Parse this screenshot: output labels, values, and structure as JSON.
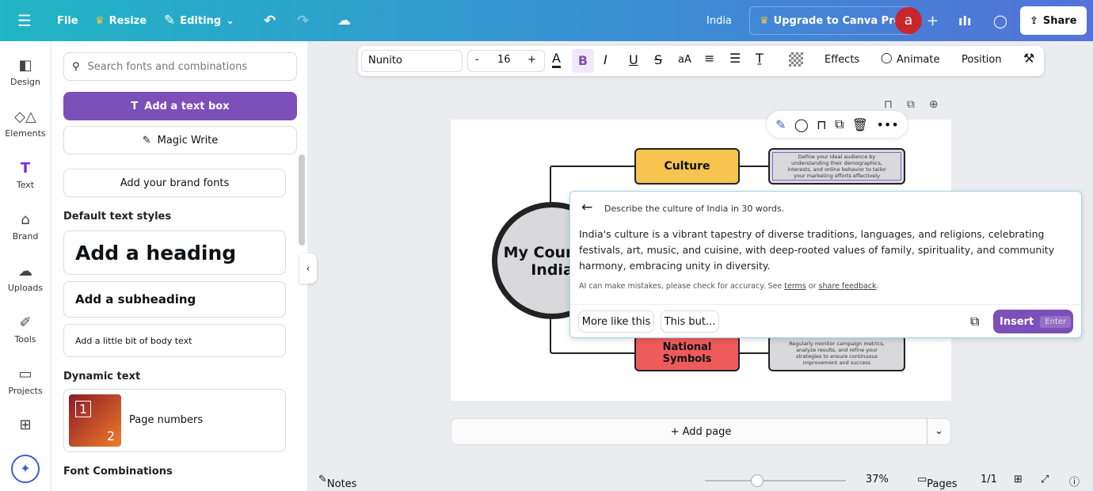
{
  "topbar": {
    "file": "File",
    "resize": "Resize",
    "editing": "Editing",
    "title": "India",
    "upgrade": "Upgrade to Canva Pro",
    "avatar": "a",
    "share": "Share"
  },
  "rail": [
    {
      "label": "Design",
      "icon": "design-icon"
    },
    {
      "label": "Elements",
      "icon": "elements-icon"
    },
    {
      "label": "Text",
      "icon": "text-icon"
    },
    {
      "label": "Brand",
      "icon": "brand-icon"
    },
    {
      "label": "Uploads",
      "icon": "uploads-icon"
    },
    {
      "label": "Tools",
      "icon": "tools-icon"
    },
    {
      "label": "Projects",
      "icon": "projects-icon"
    }
  ],
  "panel": {
    "search_placeholder": "Search fonts and combinations",
    "add_textbox": "Add a text box",
    "magic_write": "Magic Write",
    "brand_fonts": "Add your brand fonts",
    "default_styles": "Default text styles",
    "heading": "Add a heading",
    "subheading": "Add a subheading",
    "body": "Add a little bit of body text",
    "dynamic": "Dynamic text",
    "page_numbers": "Page numbers",
    "thumb_1": "1",
    "thumb_2": "2",
    "font_combos": "Font Combinations"
  },
  "toolbar": {
    "font": "Nunito",
    "minus": "-",
    "size": "16",
    "plus": "+",
    "bold": "B",
    "italic": "I",
    "underline": "U",
    "strike": "S",
    "case": "aA",
    "effects": "Effects",
    "animate": "Animate",
    "position": "Position"
  },
  "design": {
    "center_line1": "My Country",
    "center_line2": "India",
    "culture": "Culture",
    "culture_text": "Define your ideal audience by understanding their demographics, interests, and online behavior to tailor your marketing efforts effectively",
    "symbols": "National Symbols",
    "symbols_text": "Regularly monitor campaign metrics, analyze results, and refine your strategies to ensure continuous improvement and success",
    "colors": {
      "culture": "#f6c44f",
      "symbols": "#ef5b5b",
      "grey": "#d9d9db"
    }
  },
  "ai_popup": {
    "prompt": "Describe the culture of India in 30 words.",
    "result": "India's culture is a vibrant tapestry of diverse traditions, languages, and religions, celebrating festivals, art, music, and cuisine, with deep-rooted values of family, spirituality, and community harmony, embracing unity in diversity.",
    "disclaimer": "AI can make mistakes, please check for accuracy. See ",
    "terms": "terms",
    "or": " or ",
    "feedback": "share feedback",
    "dot": ".",
    "more": "More like this",
    "this_but": "This but...",
    "insert": "Insert",
    "enter": "Enter"
  },
  "add_page": "+ Add page",
  "footer": {
    "notes": "Notes",
    "zoom": "37%",
    "zoom_value": 37,
    "pages": "Pages",
    "page_count": "1/1"
  }
}
